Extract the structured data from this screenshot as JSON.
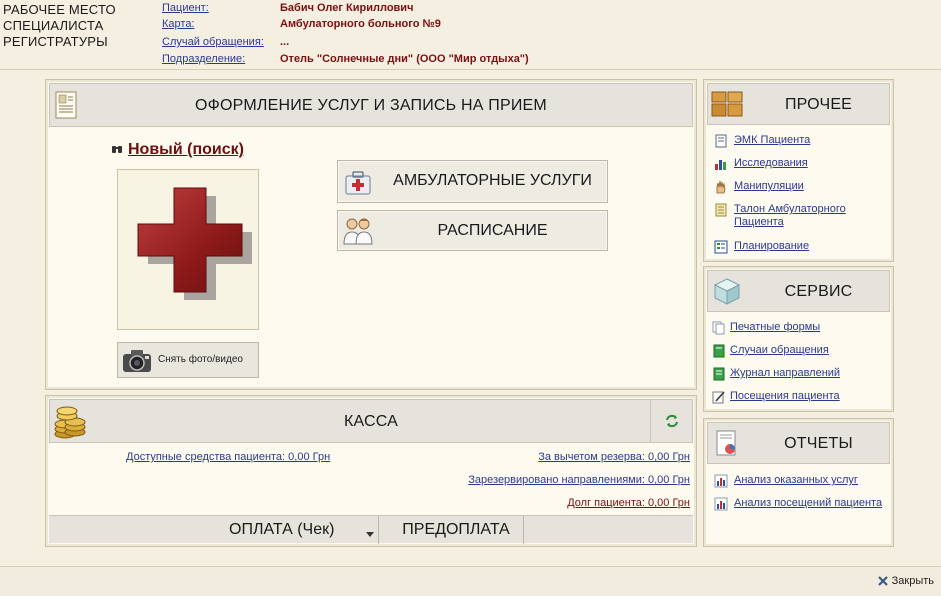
{
  "header": {
    "title": "РАБОЧЕЕ МЕСТО\nСПЕЦИАЛИСТА\nРЕГИСТРАТУРЫ",
    "patient_label": "Пациент:",
    "patient_value": "Бабич Олег Кириллович",
    "card_label": "Карта:",
    "card_value": "Амбулаторного больного №9",
    "case_label": "Случай обращения:",
    "case_value": "...",
    "dept_label": "Подразделение:",
    "dept_value": "Отель \"Солнечные дни\" (ООО \"Мир отдыха\")"
  },
  "main": {
    "title": "ОФОРМЛЕНИЕ УСЛУГ И ЗАПИСЬ НА ПРИЕМ",
    "new_search": "Новый (поиск)",
    "snap_label": "Снять фото/видео",
    "amb_services": "АМБУЛАТОРНЫЕ УСЛУГИ",
    "schedule": "РАСПИСАНИЕ"
  },
  "kassa": {
    "title": "КАССА",
    "available": "Доступные средства пациента: 0,00 Грн",
    "after_reserve": "За вычетом резерва: 0,00 Грн",
    "reserved": "Зарезервировано направлениями: 0,00 Грн",
    "debt": "Долг пациента: 0,00 Грн",
    "pay": "ОПЛАТА (Чек)",
    "prepay": "ПРЕДОПЛАТА"
  },
  "other": {
    "title": "ПРОЧЕЕ",
    "items": [
      "ЭМК Пациента",
      "Исследования",
      "Манипуляции",
      "Талон Амбулаторного Пациента",
      "Планирование"
    ]
  },
  "service": {
    "title": "СЕРВИС",
    "items": [
      "Печатные формы",
      "Случаи обращения",
      "Журнал направлений",
      "Посещения пациента"
    ]
  },
  "reports": {
    "title": "ОТЧЕТЫ",
    "items": [
      "Анализ оказанных услуг",
      "Анализ посещений пациента"
    ]
  },
  "footer": {
    "close": "Закрыть"
  },
  "colors": {
    "accent_link": "#2b3a8f",
    "dark_red": "#7b1010",
    "background": "#f4efe1"
  }
}
